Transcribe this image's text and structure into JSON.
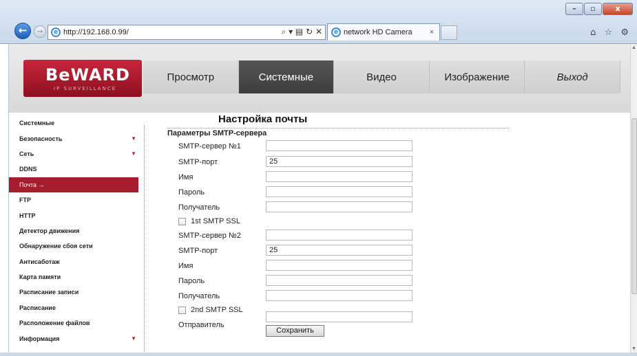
{
  "browser": {
    "url": "http://192.168.0.99/",
    "address_tools": "⌕ ▾ ▤ ↻ ✕",
    "tab_title": "network HD Camera",
    "tab_close": "×",
    "window_controls": [
      "–",
      "▫",
      "x"
    ],
    "right_icons": "⌂ ☆ ⚙"
  },
  "logo": {
    "text": "BeWARD",
    "sub": "IP SURVEILLANCE"
  },
  "menu": [
    {
      "label": "Просмотр",
      "active": false
    },
    {
      "label": "Системные",
      "active": true
    },
    {
      "label": "Видео",
      "active": false
    },
    {
      "label": "Изображение",
      "active": false
    },
    {
      "label": "Выход",
      "active": false
    }
  ],
  "sidebar": [
    {
      "label": "Системные",
      "arrow": ""
    },
    {
      "label": "Безопасность",
      "arrow": "▼"
    },
    {
      "label": "Сеть",
      "arrow": "▼"
    },
    {
      "label": "DDNS",
      "arrow": ""
    },
    {
      "label": "Почта",
      "arrow": "",
      "active": true,
      "suffix": "→"
    },
    {
      "label": "FTP",
      "arrow": ""
    },
    {
      "label": "HTTP",
      "arrow": ""
    },
    {
      "label": "Детектор движения",
      "arrow": ""
    },
    {
      "label": "Обнаружение сбоя сети",
      "arrow": ""
    },
    {
      "label": "Антисаботаж",
      "arrow": ""
    },
    {
      "label": "Карта памяти",
      "arrow": ""
    },
    {
      "label": "Расписание записи",
      "arrow": ""
    },
    {
      "label": "Расписание",
      "arrow": ""
    },
    {
      "label": "Расположение файлов",
      "arrow": ""
    },
    {
      "label": "Информация",
      "arrow": "▼"
    }
  ],
  "content": {
    "title": "Настройка почты",
    "section": "Параметры SMTP-сервера",
    "server1": {
      "server_label": "SMTP-сервер №1",
      "server_value": "",
      "port_label": "SMTP-порт",
      "port_value": "25",
      "name_label": "Имя",
      "name_value": "",
      "password_label": "Пароль",
      "password_value": "",
      "recipient_label": "Получатель",
      "recipient_value": "",
      "ssl_label": "1st SMTP SSL",
      "ssl_checked": false
    },
    "server2": {
      "server_label": "SMTP-сервер №2",
      "server_value": "",
      "port_label": "SMTP-порт",
      "port_value": "25",
      "name_label": "Имя",
      "name_value": "",
      "password_label": "Пароль",
      "password_value": "",
      "recipient_label": "Получатель",
      "recipient_value": "",
      "ssl_label": "2nd SMTP SSL",
      "ssl_checked": false
    },
    "sender_label": "Отправитель",
    "sender_value": "",
    "save_label": "Сохранить"
  }
}
